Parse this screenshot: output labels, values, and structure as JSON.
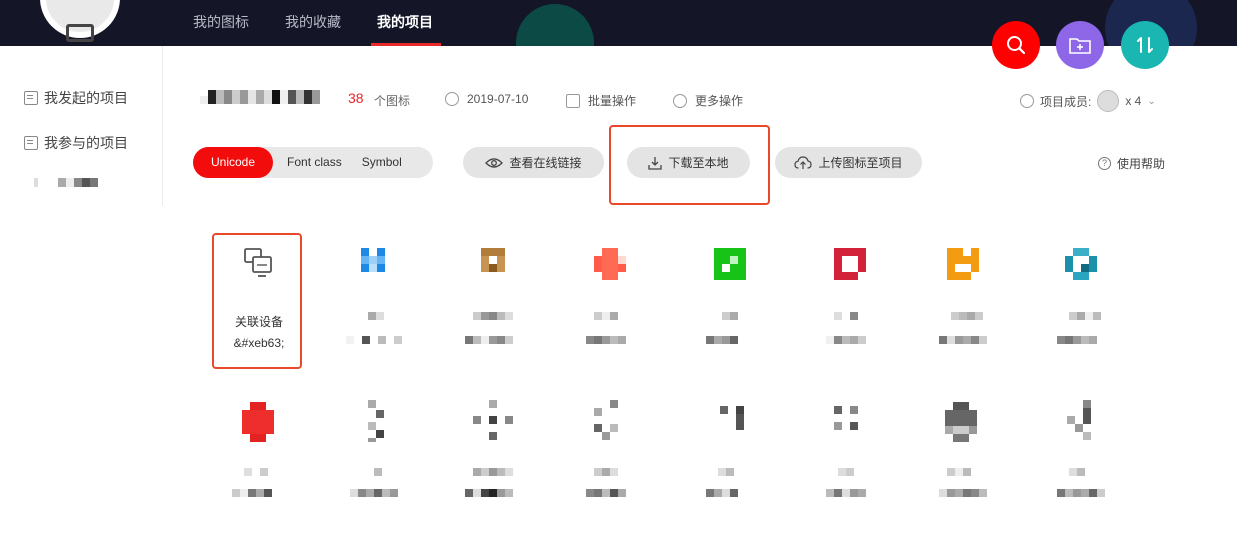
{
  "nav": {
    "tabs": [
      "我的图标",
      "我的收藏",
      "我的项目"
    ],
    "active_tab": "我的项目"
  },
  "fab": {
    "search_icon": "search-icon",
    "add_folder_icon": "add-folder-icon",
    "sort_icon": "sort-icon"
  },
  "sidebar": {
    "items": [
      "我发起的项目",
      "我参与的项目"
    ]
  },
  "project": {
    "icon_count": "38",
    "icon_count_label": "个图标",
    "date": "2019-07-10",
    "batch_label": "批量操作",
    "more_label": "更多操作",
    "members_label": "项目成员:",
    "members_count": "x 4"
  },
  "toolbar": {
    "formats": [
      "Unicode",
      "Font class",
      "Symbol"
    ],
    "active_format": "Unicode",
    "view_link_label": "查看在线链接",
    "download_label": "下载至本地",
    "upload_label": "上传图标至项目",
    "help_label": "使用帮助"
  },
  "first_icon": {
    "name": "关联设备",
    "code": "&#xeb63;"
  },
  "colors": {
    "accent": "#f20c0c",
    "highlight": "#e9492b",
    "nav_bg": "#141628"
  }
}
